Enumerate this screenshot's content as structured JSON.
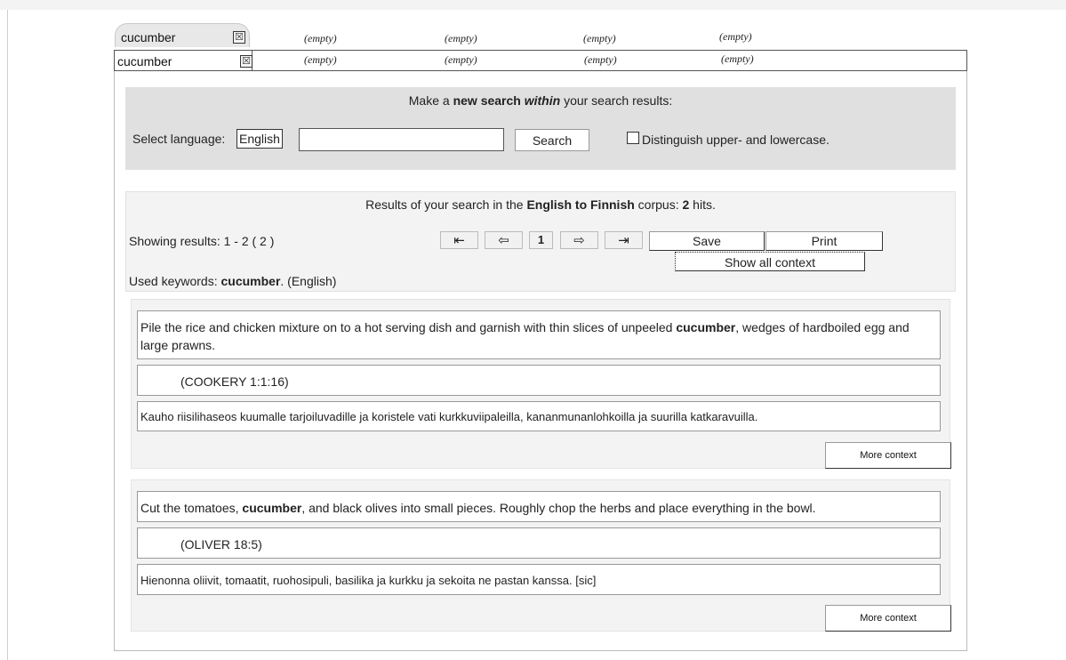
{
  "tabs": {
    "row1": {
      "term": "cucumber",
      "slots": [
        "(empty)",
        "(empty)",
        "(empty)",
        "(empty)"
      ]
    },
    "row2": {
      "term": "cucumber",
      "slots": [
        "(empty)",
        "(empty)",
        "(empty)",
        "(empty)"
      ]
    },
    "close_glyph": "☒"
  },
  "search": {
    "prompt_pre": "Make a",
    "prompt_new_search": "new search",
    "prompt_within": "within",
    "prompt_post": "your search results:",
    "select_language_label": "Select language:",
    "language": "English",
    "query_value": "",
    "search_button": "Search",
    "case_label": "Distinguish upper- and lowercase."
  },
  "results": {
    "summary_pre": "Results of your search in the",
    "corpus": "English to Finnish",
    "summary_mid": "corpus:",
    "hits": "2",
    "summary_post": "hits.",
    "showing": "Showing results: 1 - 2 ( 2 )",
    "keywords_label": "Used keywords:",
    "keyword": "cucumber",
    "keyword_lang": ". (English)",
    "page": "1",
    "save_button": "Save",
    "print_button": "Print",
    "show_all_context": "Show all context",
    "nav_first_icon": "first-page-icon",
    "nav_prev_icon": "prev-page-icon",
    "nav_next_icon": "next-page-icon",
    "nav_last_icon": "last-page-icon"
  },
  "hits": [
    {
      "source_pre": "Pile the rice and chicken mixture on to a hot serving dish and garnish with thin slices of unpeeled",
      "source_kw": "cucumber",
      "source_post": ", wedges of hardboiled egg and large prawns.",
      "reference": "(COOKERY 1:1:16)",
      "translation": "Kauho riisilihaseos kuumalle tarjoiluvadille ja koristele vati kurkkuviipaleilla, kananmunanlohkoilla ja suurilla katkaravuilla.",
      "more": "More context"
    },
    {
      "source_pre": "Cut the tomatoes,",
      "source_kw": "cucumber",
      "source_post": ", and black olives into small pieces. Roughly chop the herbs and place everything in the bowl.",
      "reference": "(OLIVER 18:5)",
      "translation": "Hienonna oliivit, tomaatit, ruohosipuli, basilika ja kurkku ja sekoita ne pastan kanssa. [sic]",
      "more": "More context"
    }
  ]
}
